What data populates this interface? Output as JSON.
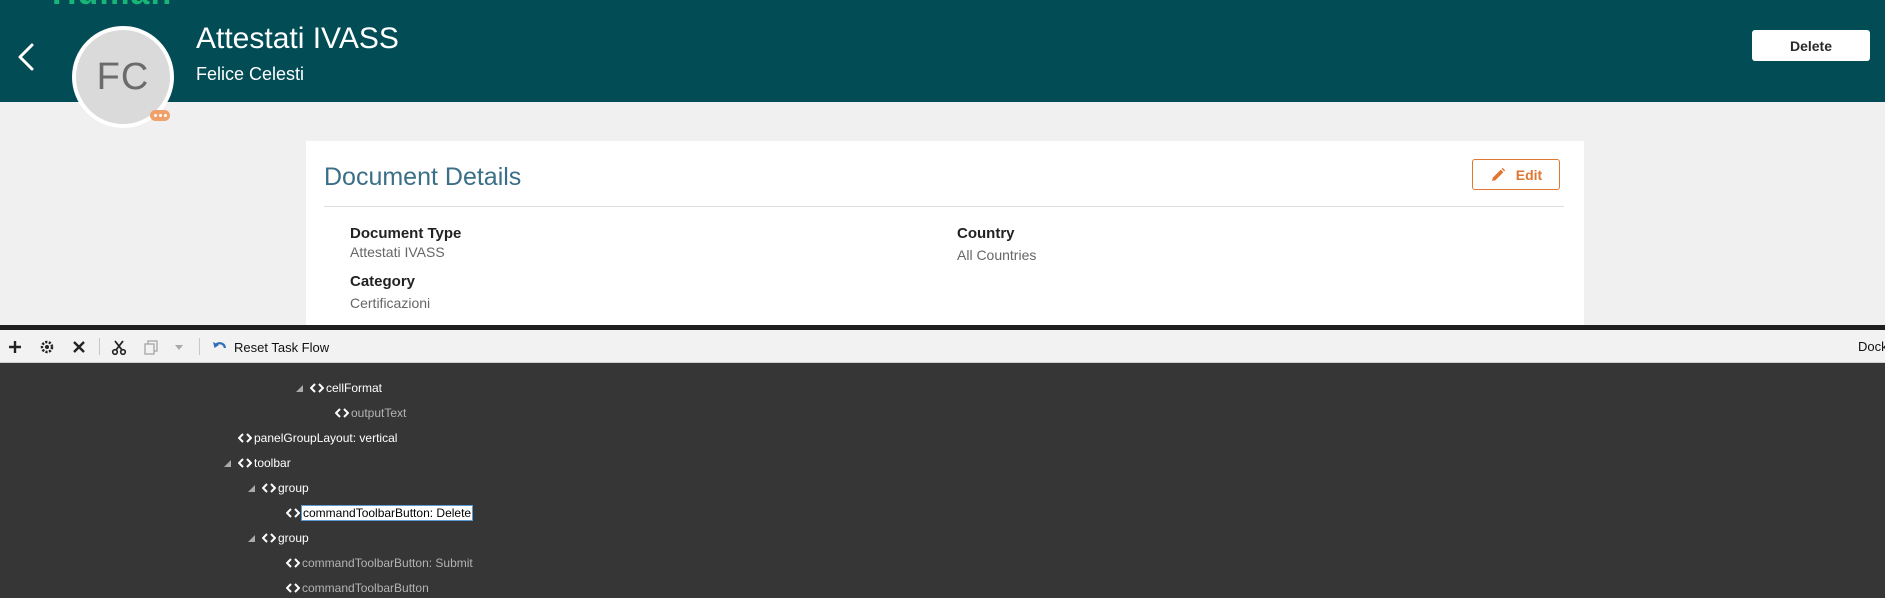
{
  "header": {
    "brand": "Human",
    "avatar_initials": "FC",
    "title": "Attestati IVASS",
    "subtitle": "Felice Celesti",
    "delete_label": "Delete",
    "bg_color": "#024c56"
  },
  "card": {
    "title": "Document Details",
    "edit_label": "Edit",
    "fields": {
      "document_type": {
        "label": "Document Type",
        "value": "Attestati IVASS"
      },
      "country": {
        "label": "Country",
        "value": "All Countries"
      },
      "category": {
        "label": "Category",
        "value": "Certificazioni"
      }
    }
  },
  "devtools": {
    "toolbar": {
      "icons": [
        "add-icon",
        "settings-icon",
        "remove-icon",
        "cut-icon",
        "copy-icon",
        "dropdown-icon"
      ],
      "reset_label": "Reset Task Flow",
      "dock_label": "Dock"
    },
    "tree": [
      {
        "label": "cellFormat",
        "expanded": true
      },
      {
        "label": "outputText",
        "dim": true
      },
      {
        "label": "panelGroupLayout: vertical"
      },
      {
        "label": "toolbar",
        "expanded": true
      },
      {
        "label": "group",
        "expanded": true
      },
      {
        "label": "commandToolbarButton: Delete",
        "selected": true
      },
      {
        "label": "group",
        "expanded": true
      },
      {
        "label": "commandToolbarButton: Submit",
        "dim": true
      },
      {
        "label": "commandToolbarButton",
        "dim": true
      }
    ]
  },
  "colors": {
    "accent_orange": "#e0762f",
    "card_title": "#3a6f87",
    "selection_outline": "#5b9bd5"
  }
}
